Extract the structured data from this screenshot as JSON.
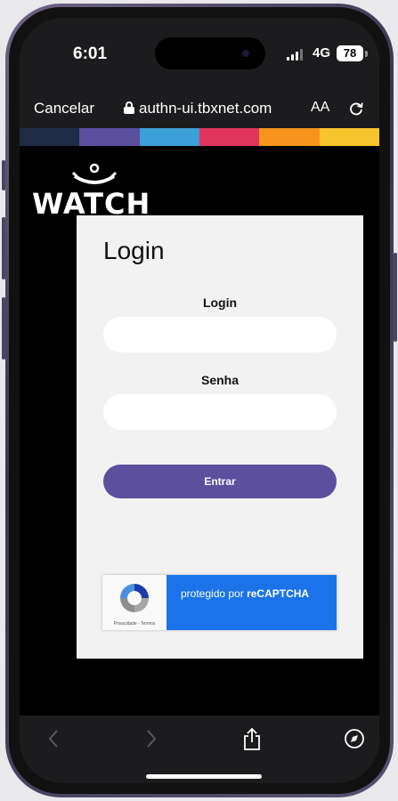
{
  "status_bar": {
    "time": "6:01",
    "network": "4G",
    "battery": "78"
  },
  "address_bar": {
    "cancel_label": "Cancelar",
    "url": "authn-ui.tbxnet.com",
    "text_size_label": "AA"
  },
  "stripe_colors": [
    "#1f2a44",
    "#5b4f9e",
    "#3b9fd8",
    "#e0345f",
    "#f7941d",
    "#f7c42e"
  ],
  "header": {
    "logo_text": "WATCH"
  },
  "login_card": {
    "title": "Login",
    "login_label": "Login",
    "login_value": "",
    "password_label": "Senha",
    "password_value": "",
    "submit_label": "Entrar"
  },
  "recaptcha": {
    "prefix": "protegido por ",
    "brand": "reCAPTCHA",
    "terms": "Privacidade - Termos"
  },
  "colors": {
    "accent": "#5b4f9e",
    "recaptcha_blue": "#1a73e8"
  },
  "toolbar": {
    "icons": [
      "back-icon",
      "forward-icon",
      "share-icon",
      "compass-icon"
    ]
  }
}
